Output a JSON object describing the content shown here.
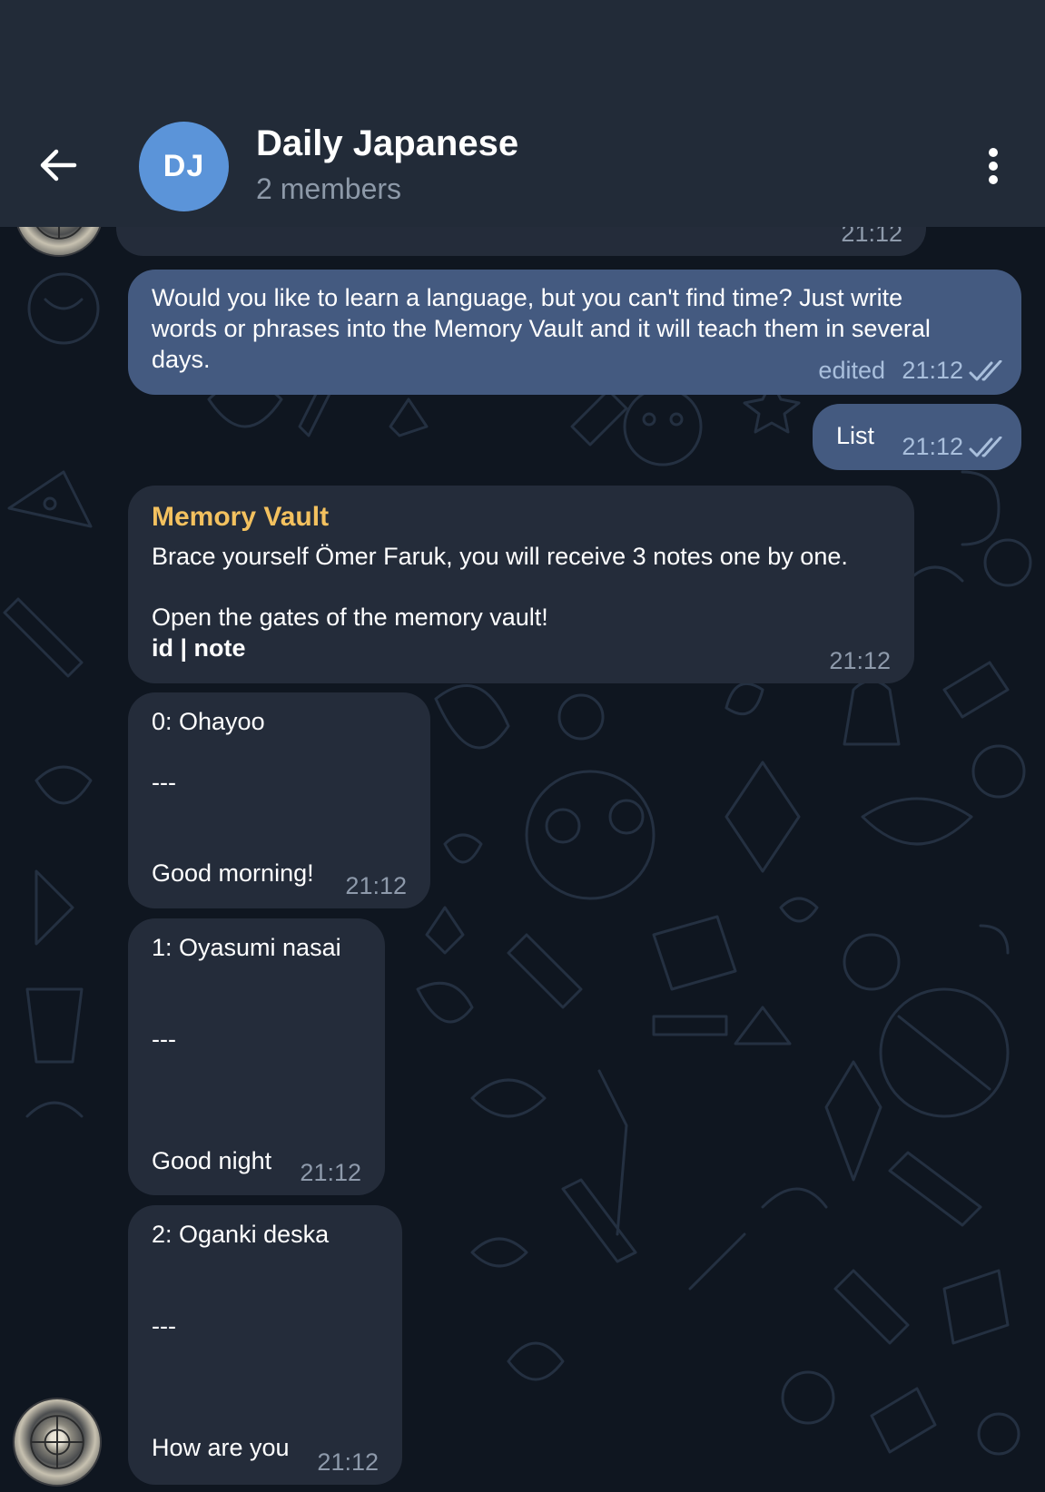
{
  "header": {
    "avatar_initials": "DJ",
    "title": "Daily Japanese",
    "subtitle": "2 members"
  },
  "colors": {
    "header_bg": "#222b38",
    "chat_bg": "#0f1620",
    "incoming_bubble": "#242c3a",
    "outgoing_bubble": "#445a80",
    "avatar_blue": "#5b94d9",
    "sender_name": "#f3c15f"
  },
  "messages": {
    "prev_time": "21:12",
    "m1": {
      "lines": [
        "Would you like to learn a language, but you can't find time? Just write",
        "words or phrases into the Memory Vault and it will teach them in several",
        "days."
      ],
      "edited": "edited",
      "time": "21:12"
    },
    "m2": {
      "text": "List",
      "time": "21:12"
    },
    "m3": {
      "sender": "Memory Vault",
      "line1": "Brace yourself Ömer Faruk, you will receive 3 notes one by one.",
      "line2": "Open the gates of the memory vault!",
      "line3": "id | note",
      "time": "21:12"
    },
    "n0": {
      "head": "0: Ohayoo",
      "sep": "---",
      "body": "Good morning!",
      "time": "21:12"
    },
    "n1": {
      "head": "1: Oyasumi nasai",
      "sep": "---",
      "body": "Good night",
      "time": "21:12"
    },
    "n2": {
      "head": "2: Oganki deska",
      "sep": "---",
      "body": "How are you",
      "time": "21:12"
    }
  }
}
